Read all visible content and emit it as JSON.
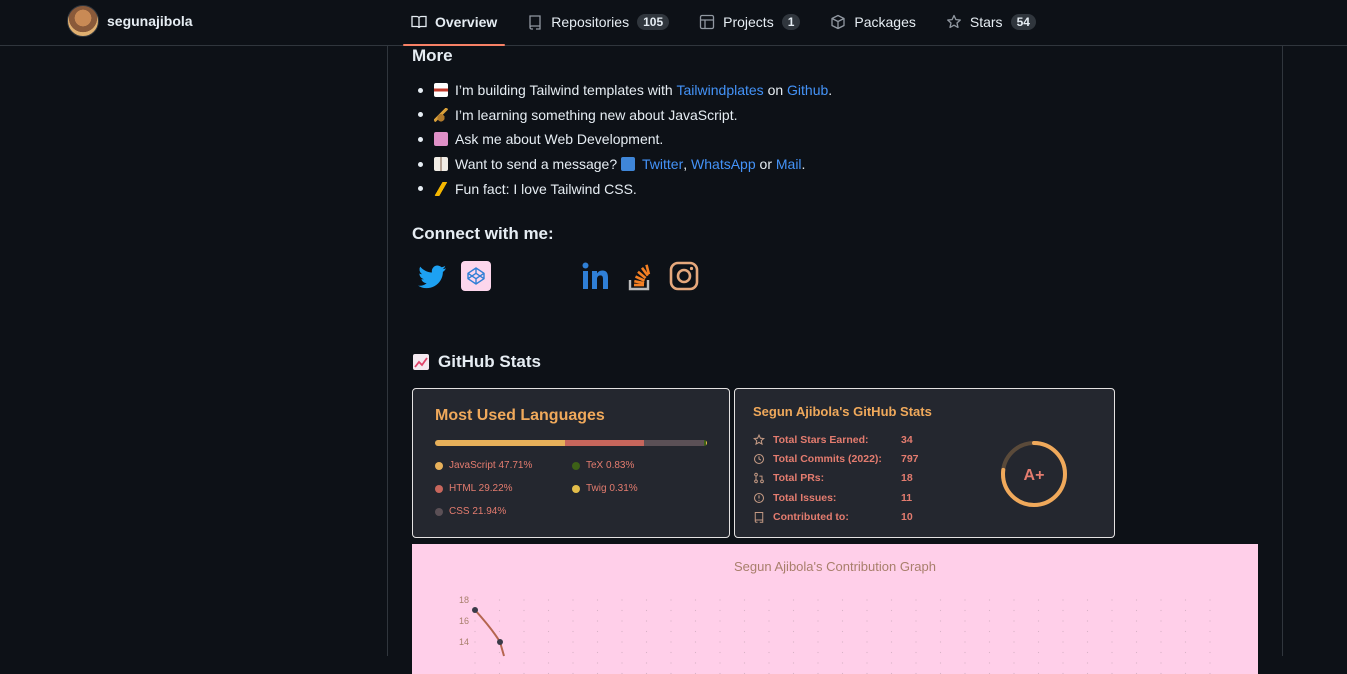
{
  "header": {
    "username": "segunajibola",
    "tabs": [
      {
        "label": "Overview",
        "count": ""
      },
      {
        "label": "Repositories",
        "count": "105"
      },
      {
        "label": "Projects",
        "count": "1"
      },
      {
        "label": "Packages",
        "count": ""
      },
      {
        "label": "Stars",
        "count": "54"
      }
    ]
  },
  "readme": {
    "more_heading": "More",
    "facts": [
      {
        "pre": "I’m building Tailwind templates with ",
        "link1": "Tailwindplates",
        "mid": " on ",
        "link2": "Github",
        "post": "."
      },
      {
        "text": "I’m learning something new about JavaScript."
      },
      {
        "text": "Ask me about Web Development."
      },
      {
        "pre": "Want to send a message? ",
        "link1": "Twitter",
        "sep1": ", ",
        "link2": "WhatsApp",
        "sep2": " or ",
        "link3": "Mail",
        "post": "."
      },
      {
        "text": "Fun fact: I love Tailwind CSS."
      }
    ],
    "connect_heading": "Connect with me:",
    "stats_heading": "GitHub Stats"
  },
  "languages_card": {
    "title": "Most Used Languages",
    "items": [
      {
        "label": "JavaScript 47.71%",
        "percent": 47.71,
        "color": "#e7b05a"
      },
      {
        "label": "TeX 0.83%",
        "percent": 0.83,
        "color": "#3d6117"
      },
      {
        "label": "HTML 29.22%",
        "percent": 29.22,
        "color": "#c7665c"
      },
      {
        "label": "Twig 0.31%",
        "percent": 0.31,
        "color": "#e3bd4a"
      },
      {
        "label": "CSS 21.94%",
        "percent": 21.94,
        "color": "#5b5056"
      }
    ]
  },
  "stats_card": {
    "title": "Segun Ajibola's GitHub Stats",
    "rows": [
      {
        "label": "Total Stars Earned:",
        "value": "34"
      },
      {
        "label": "Total Commits (2022):",
        "value": "797"
      },
      {
        "label": "Total PRs:",
        "value": "18"
      },
      {
        "label": "Total Issues:",
        "value": "11"
      },
      {
        "label": "Contributed to:",
        "value": "10"
      }
    ],
    "rank": "A+"
  },
  "contribution_graph": {
    "title": "Segun Ajibola's Contribution Graph",
    "y_ticks": [
      "18",
      "16",
      "14"
    ]
  },
  "colors": {
    "accent": "#f78166",
    "link": "#4493f8",
    "card_title": "#f0a95b",
    "card_text": "#e47c6f",
    "graph_bg": "#ffcfe9"
  }
}
